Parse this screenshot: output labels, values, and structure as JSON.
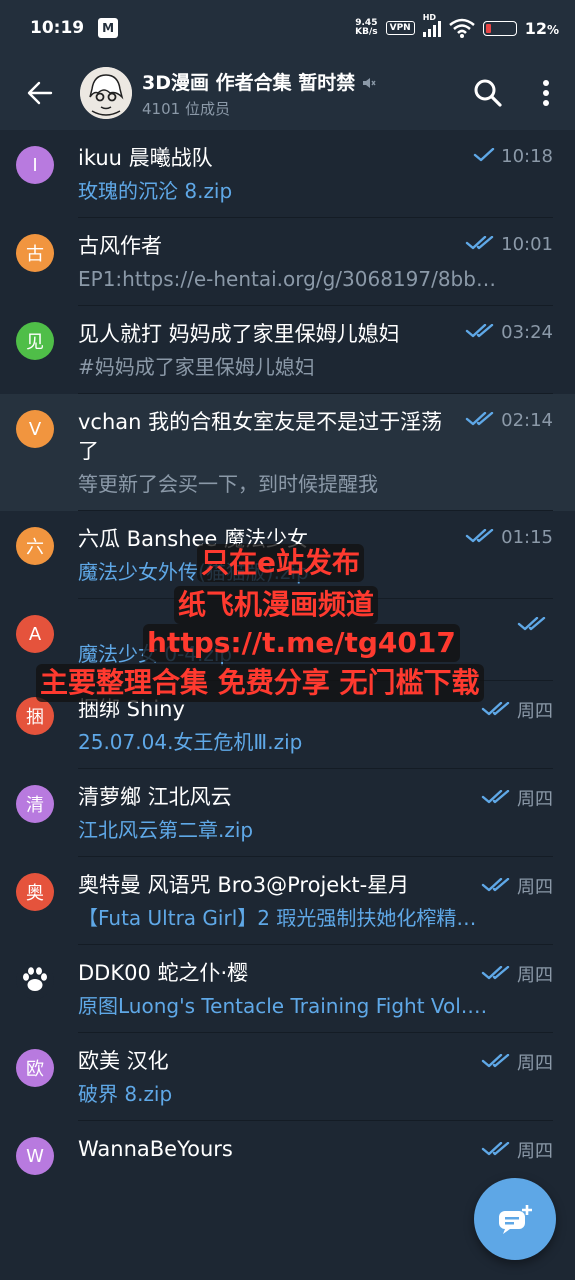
{
  "status": {
    "time": "10:19",
    "mail_icon_letter": "M",
    "net_speed_top": "9.45",
    "net_speed_bottom": "KB/s",
    "vpn": "VPN",
    "hd": "HD",
    "battery": "12"
  },
  "header": {
    "title": "3D漫画 作者合集 暂时禁",
    "subtitle": "4101 位成员"
  },
  "chats": [
    {
      "initial": "I",
      "color": "#b87adf",
      "name": "ikuu 晨曦战队",
      "time": "10:18",
      "ticks": "single",
      "preview": "玫瑰的沉沦 8.zip",
      "link": true
    },
    {
      "initial": "古",
      "color": "#f1953f",
      "name": "古风作者",
      "time": "10:01",
      "ticks": "double",
      "preview": "EP1:https://e-hentai.org/g/3068197/8bb…",
      "link": false
    },
    {
      "initial": "见",
      "color": "#4fbe48",
      "name": "见人就打 妈妈成了家里保姆儿媳妇",
      "time": "03:24",
      "ticks": "double",
      "preview": "#妈妈成了家里保姆儿媳妇",
      "link": false
    },
    {
      "initial": "V",
      "color": "#f1953f",
      "name": "vchan 我的合租女室友是不是过于淫荡了",
      "time": "02:14",
      "ticks": "double",
      "preview": "等更新了会买一下，到时候提醒我",
      "link": false
    },
    {
      "initial": "六",
      "color": "#f1953f",
      "name": "六瓜 Banshee 魔法少女",
      "time": "01:15",
      "ticks": "double",
      "preview": "魔法少女外传(猫猫版).zip",
      "link": true
    },
    {
      "initial": "A",
      "color": "#e5533c",
      "name": "",
      "time": "",
      "ticks": "double",
      "preview": "魔法少女 0-4.zip",
      "link": true
    },
    {
      "initial": "捆",
      "color": "#e5533c",
      "name": "捆绑 Shiny",
      "time": "周四",
      "ticks": "double",
      "preview": "25.07.04.女王危机Ⅲ.zip",
      "link": true
    },
    {
      "initial": "清",
      "color": "#b87adf",
      "name": "清萝鄉 江北风云",
      "time": "周四",
      "ticks": "double",
      "preview": "江北风云第二章.zip",
      "link": true
    },
    {
      "initial": "奥",
      "color": "#e5533c",
      "name": "奥特曼 风语咒 Bro3@Projekt-星月",
      "time": "周四",
      "ticks": "double",
      "preview": "【Futa Ultra Girl】2 瑕光强制扶她化榨精…",
      "link": true
    },
    {
      "initial": "",
      "color": "#1d2733",
      "name": "DDK00 蛇之仆·樱",
      "time": "周四",
      "ticks": "double",
      "preview": "原图Luong's Tentacle Training Fight Vol.…",
      "link": true
    },
    {
      "initial": "欧",
      "color": "#b87adf",
      "name": "欧美 汉化",
      "time": "周四",
      "ticks": "double",
      "preview": "破界 8.zip",
      "link": true
    },
    {
      "initial": "W",
      "color": "#b87adf",
      "name": "WannaBeYours",
      "time": "周四",
      "ticks": "double",
      "preview": "",
      "link": true
    }
  ],
  "overlay": {
    "line1": "只在e站发布",
    "line2": "纸飞机漫画频道",
    "line3": "https://t.me/tg4017",
    "line4": "主要整理合集 免费分享 无门槛下载"
  },
  "icons": {
    "back": "back-arrow-icon",
    "search": "search-icon",
    "more": "more-vert-icon",
    "mute": "muted-speaker-icon",
    "fab": "new-message-icon",
    "paw": "paw-icon",
    "wifi": "wifi-icon",
    "signal": "signal-icon",
    "battery": "battery-icon"
  }
}
